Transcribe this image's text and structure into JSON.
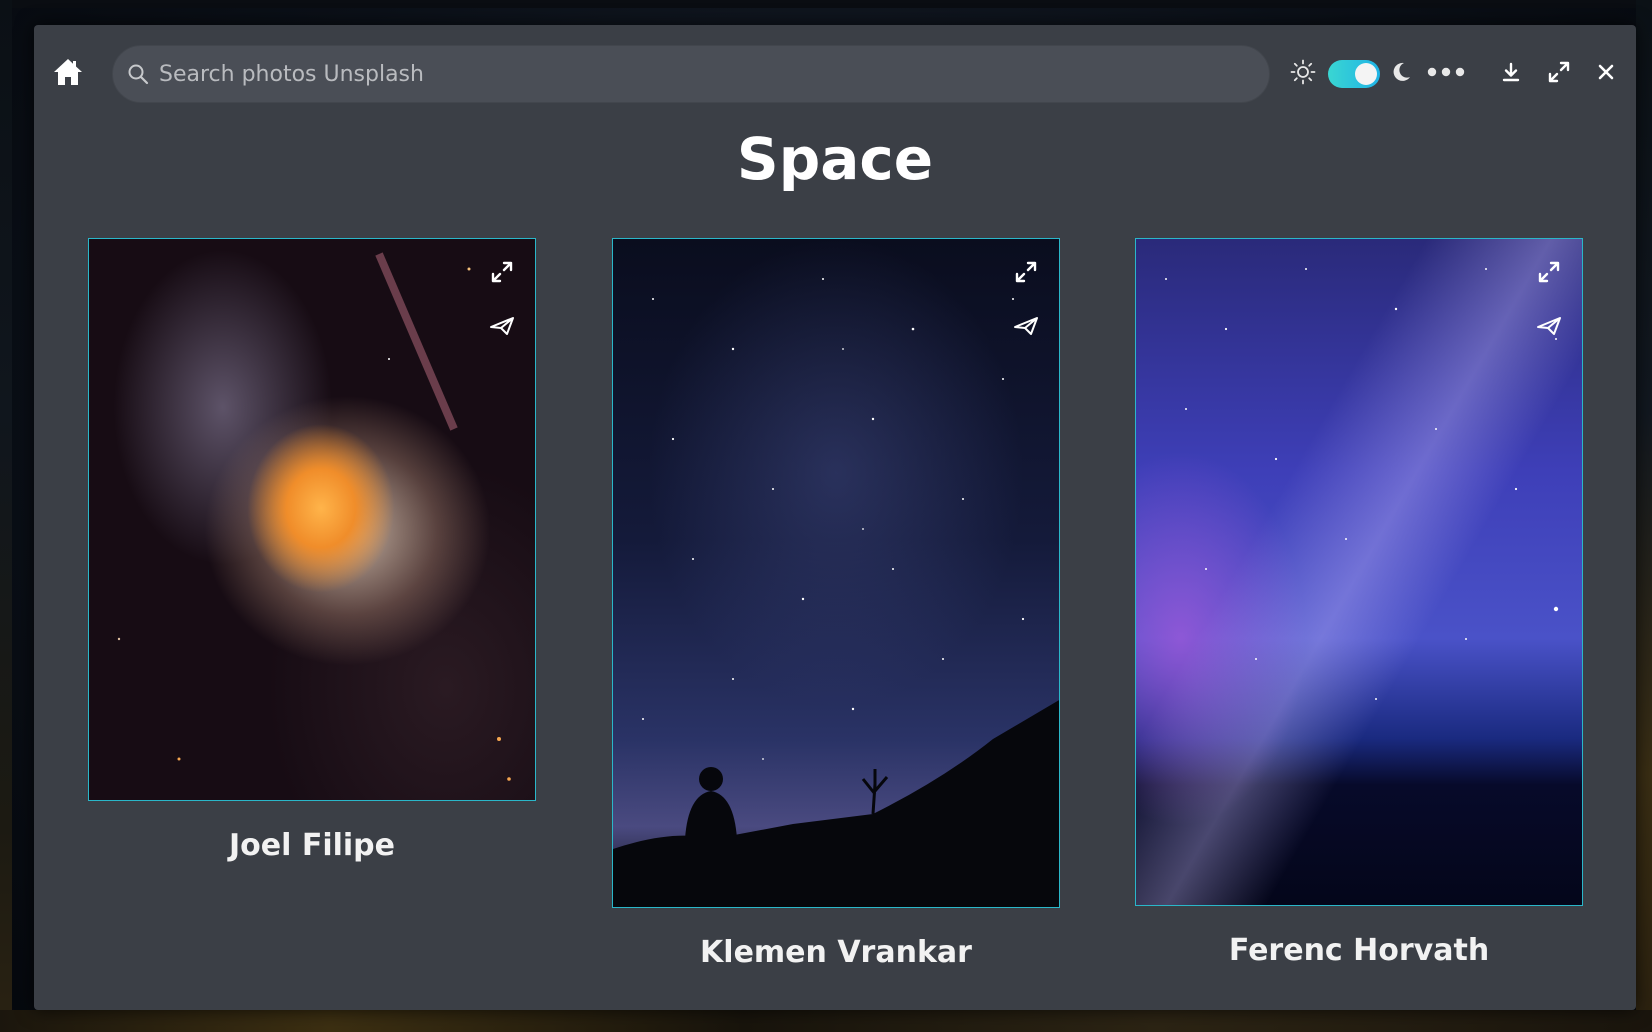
{
  "header": {
    "search": {
      "placeholder": "Search photos Unsplash",
      "value": ""
    },
    "theme_toggle_on": true
  },
  "collection": {
    "title": "Space"
  },
  "photos": [
    {
      "author": "Joel Filipe"
    },
    {
      "author": "Klemen Vrankar"
    },
    {
      "author": "Ferenc Horvath"
    }
  ],
  "icons": {
    "home": "home-icon",
    "search": "search-icon",
    "light_mode": "sun-icon",
    "dark_mode": "moon-icon",
    "menu": "more-icon",
    "download": "download-icon",
    "fullscreen": "maximize-icon",
    "close": "close-icon",
    "photo_expand": "expand-icon",
    "photo_share": "send-icon"
  },
  "colors": {
    "window_bg": "#3b3f46",
    "search_bg": "#4a4e56",
    "accent_border": "#2ab7c9",
    "toggle_gradient_start": "#3ad6d2",
    "toggle_gradient_end": "#1fb3e6"
  }
}
